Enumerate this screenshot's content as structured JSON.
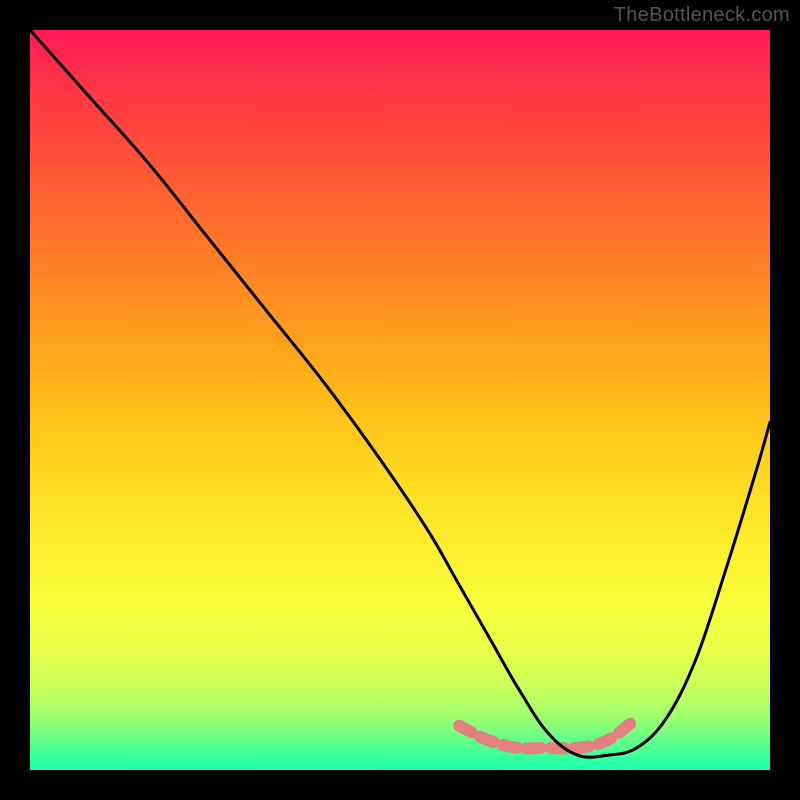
{
  "watermark": "TheBottleneck.com",
  "chart_data": {
    "type": "line",
    "title": "",
    "xlabel": "",
    "ylabel": "",
    "xlim": [
      0,
      100
    ],
    "ylim": [
      0,
      100
    ],
    "grid": false,
    "legend": false,
    "series": [
      {
        "name": "bottleneck-curve",
        "x": [
          0,
          8,
          16,
          24,
          32,
          40,
          48,
          54,
          58,
          62,
          66,
          70,
          74,
          78,
          82,
          86,
          90,
          94,
          98,
          100
        ],
        "values": [
          100,
          91,
          82,
          72,
          62,
          52,
          41,
          32,
          25,
          18,
          11,
          5,
          2,
          2,
          3,
          7,
          15,
          27,
          40,
          47
        ]
      },
      {
        "name": "highlight-band",
        "x": [
          58,
          62,
          66,
          70,
          74,
          78,
          82
        ],
        "values": [
          6,
          4,
          3,
          3,
          3,
          4,
          7
        ]
      }
    ],
    "annotations": [
      {
        "text": "TheBottleneck.com",
        "position": "top-right"
      }
    ],
    "colors": {
      "curve": "#000000",
      "highlight": "#e48080",
      "gradient_top": "#ff1a55",
      "gradient_mid": "#ffd820",
      "gradient_bottom": "#18ffb0",
      "background": "#000000"
    }
  }
}
